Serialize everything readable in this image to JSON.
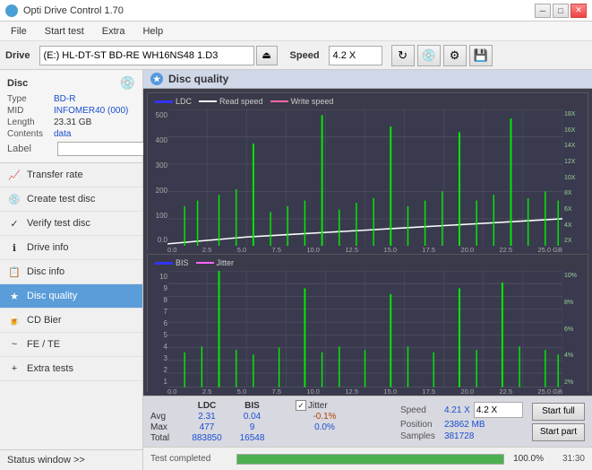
{
  "titleBar": {
    "title": "Opti Drive Control 1.70",
    "minBtn": "─",
    "maxBtn": "□",
    "closeBtn": "✕"
  },
  "menuBar": {
    "items": [
      "File",
      "Start test",
      "Extra",
      "Help"
    ]
  },
  "driveToolbar": {
    "driveLabel": "Drive",
    "driveValue": "(E:)  HL-DT-ST BD-RE  WH16NS48 1.D3",
    "speedLabel": "Speed",
    "speedValue": "4.2 X"
  },
  "discPanel": {
    "typeLabel": "Type",
    "typeValue": "BD-R",
    "midLabel": "MID",
    "midValue": "INFOMER40 (000)",
    "lengthLabel": "Length",
    "lengthValue": "23.31 GB",
    "contentsLabel": "Contents",
    "contentsValue": "data",
    "labelLabel": "Label",
    "labelValue": ""
  },
  "navItems": [
    {
      "id": "transfer-rate",
      "label": "Transfer rate",
      "icon": "📈"
    },
    {
      "id": "create-test-disc",
      "label": "Create test disc",
      "icon": "💿"
    },
    {
      "id": "verify-test-disc",
      "label": "Verify test disc",
      "icon": "✓"
    },
    {
      "id": "drive-info",
      "label": "Drive info",
      "icon": "ℹ"
    },
    {
      "id": "disc-info",
      "label": "Disc info",
      "icon": "📋"
    },
    {
      "id": "disc-quality",
      "label": "Disc quality",
      "icon": "★",
      "active": true
    },
    {
      "id": "cd-bier",
      "label": "CD Bier",
      "icon": "🍺"
    },
    {
      "id": "fe-te",
      "label": "FE / TE",
      "icon": "~"
    },
    {
      "id": "extra-tests",
      "label": "Extra tests",
      "icon": "+"
    }
  ],
  "statusWindow": "Status window >>",
  "discQuality": {
    "title": "Disc quality",
    "chart1": {
      "legend": [
        "LDC",
        "Read speed",
        "Write speed"
      ],
      "yLabels": [
        "500",
        "400",
        "300",
        "200",
        "100",
        "0.0"
      ],
      "yLabelsRight": [
        "18X",
        "16X",
        "14X",
        "12X",
        "10X",
        "8X",
        "6X",
        "4X",
        "2X"
      ],
      "xLabels": [
        "0.0",
        "2.5",
        "5.0",
        "7.5",
        "10.0",
        "12.5",
        "15.0",
        "17.5",
        "20.0",
        "22.5",
        "25.0 GB"
      ]
    },
    "chart2": {
      "legend": [
        "BIS",
        "Jitter"
      ],
      "yLabels": [
        "10",
        "9",
        "8",
        "7",
        "6",
        "5",
        "4",
        "3",
        "2",
        "1"
      ],
      "yLabelsRight": [
        "10%",
        "8%",
        "6%",
        "4%",
        "2%"
      ],
      "xLabels": [
        "0.0",
        "2.5",
        "5.0",
        "7.5",
        "10.0",
        "12.5",
        "15.0",
        "17.5",
        "20.0",
        "22.5",
        "25.0 GB"
      ]
    }
  },
  "stats": {
    "headers": [
      "",
      "LDC",
      "BIS",
      "",
      "Jitter",
      "Speed",
      ""
    ],
    "rows": [
      {
        "label": "Avg",
        "ldc": "2.31",
        "bis": "0.04",
        "jitter": "-0.1%",
        "speed": "4.21 X",
        "speedSelect": "4.2 X"
      },
      {
        "label": "Max",
        "ldc": "477",
        "bis": "9",
        "jitter": "0.0%"
      },
      {
        "label": "Total",
        "ldc": "883850",
        "bis": "16548"
      }
    ],
    "position": {
      "label": "Position",
      "value": "23862 MB"
    },
    "samples": {
      "label": "Samples",
      "value": "381728"
    },
    "jitterChecked": true,
    "startFull": "Start full",
    "startPart": "Start part"
  },
  "progressBar": {
    "label": "Test completed",
    "percent": 100,
    "percentText": "100.0%",
    "time": "31:30"
  },
  "colors": {
    "ldcLine": "#00cc00",
    "readSpeedLine": "#ffffff",
    "bisLine": "#00cc00",
    "jitterLine": "#ff00ff",
    "chartBg": "#3a3a4e",
    "gridLine": "#555566",
    "activeNav": "#5b9dd9"
  }
}
